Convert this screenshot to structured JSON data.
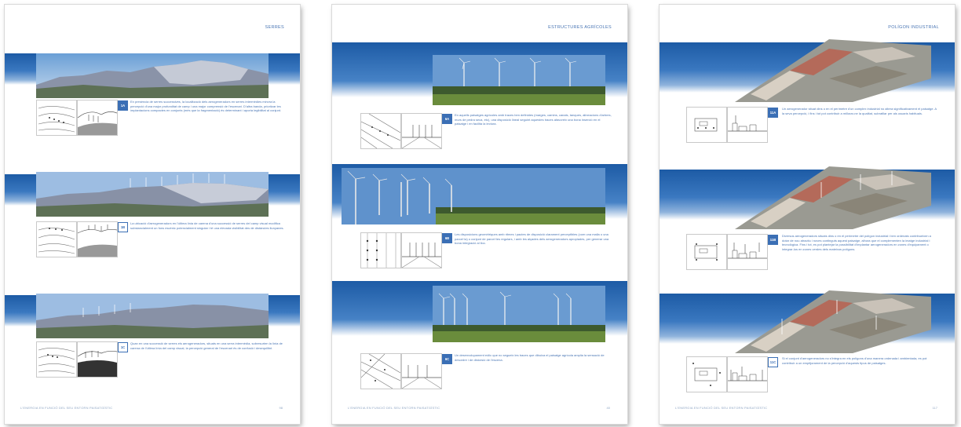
{
  "pages": [
    {
      "title": "SERRES",
      "footer": "L'ENERGIA EN FUNCIÓ DEL SEU ENTORN PAISATGÍSTIC",
      "page_number": "98",
      "items": [
        {
          "code": "1A",
          "text": "En presència de serres successives, la localització dels aerogeneradors en serres intermèdies minvra la percepció d'una major profunditat de camp i una major comprensió de l'escenari. D'altra banda, prioritzar les implantacions compactes en conjunts (més que la fragmentació) és determinant i aporta legibilitat al conjunt."
        },
        {
          "code": "1B",
          "text": "La ubicació d'aerogeneradors en l'última línia de carena d'una successió de serres del camp visual modifica substancialment un fons escènic potencialment singular i té una elevada visibilitat des de distàncies llunyanes."
        },
        {
          "code": "1C",
          "text": "Quan en una successió de serres els aerogeneradors, situats en una serra intermèdia, sobresurten la línia de carena de l'última línia del camp visual, la percepció general de l'escenari és de confusió i desequilibri."
        }
      ]
    },
    {
      "title": "ESTRUCTURES AGRÍCOLES",
      "footer": "L'ENERGIA EN FUNCIÓ DEL SEU ENTORN PAISATGÍSTIC",
      "page_number": "40",
      "items": [
        {
          "code": "6A",
          "text": "En aquells paisatges agrícoles amb traces ben definides (marges, camins, canals, tanques, alineacions d'arbres, murs de pedra seca, etc), una disposició lineal seguint aquestes traces afavoreix una bona inserció en el paisatge i en facilita la lectura."
        },
        {
          "code": "6B",
          "text": "Les disposicions geomètriques amb ritmes i pautes de disposició clarament perceptibles (com una malla o una parcel·la) o conjunt de parcel·les regulars, i amb les alçades dels aerogeneradors apropiades, per generar una bona integració al lloc."
        },
        {
          "code": "6C",
          "text": "Un desenvolupament eòlic que no segueix les traces que dibuixa el paisatge agrícola amplia la sensació de desordre i de distorsió de l'escena."
        }
      ]
    },
    {
      "title": "POLÍGON INDUSTRIAL",
      "footer": "L'ENERGIA EN FUNCIÓ DEL SEU ENTORN PAISATGÍSTIC",
      "page_number": "117",
      "items": [
        {
          "code": "11A",
          "text": "Un aerogenerador situat dins o en el perímetre d'un complex industrial no altera significativament el paisatge. A la seva percepció, i fins i tot pot contribuir a millorar-ne la qualitat, subratllar per als usuaris habituals."
        },
        {
          "code": "11B",
          "text": "Diversos aerogeneradors situats dins o en el perímetre del polígon industrial i ben ordenats contribueixen a dotar de nou atractiu i noves continguts aquest paisatge, alhora que el complementen la imatge industrial i tecnològica. Fins i tot, es pot plantejar la possibilitat d'implantar aerogeneradors en zones d'equipament o integrar-los en zones verdes dels mateixos polígons."
        },
        {
          "code": "11C",
          "text": "Si el conjunt d'aerogeneradors no s'integra en els polígons d'una manera ordenada i ambientada, es pot contribuir a un empitjorament de la percepció d'aquests tipus de paisatges."
        }
      ]
    }
  ],
  "colors": {
    "accent": "#3b6fb5",
    "sky": "#1d5ba5",
    "text": "#4a76b4"
  }
}
